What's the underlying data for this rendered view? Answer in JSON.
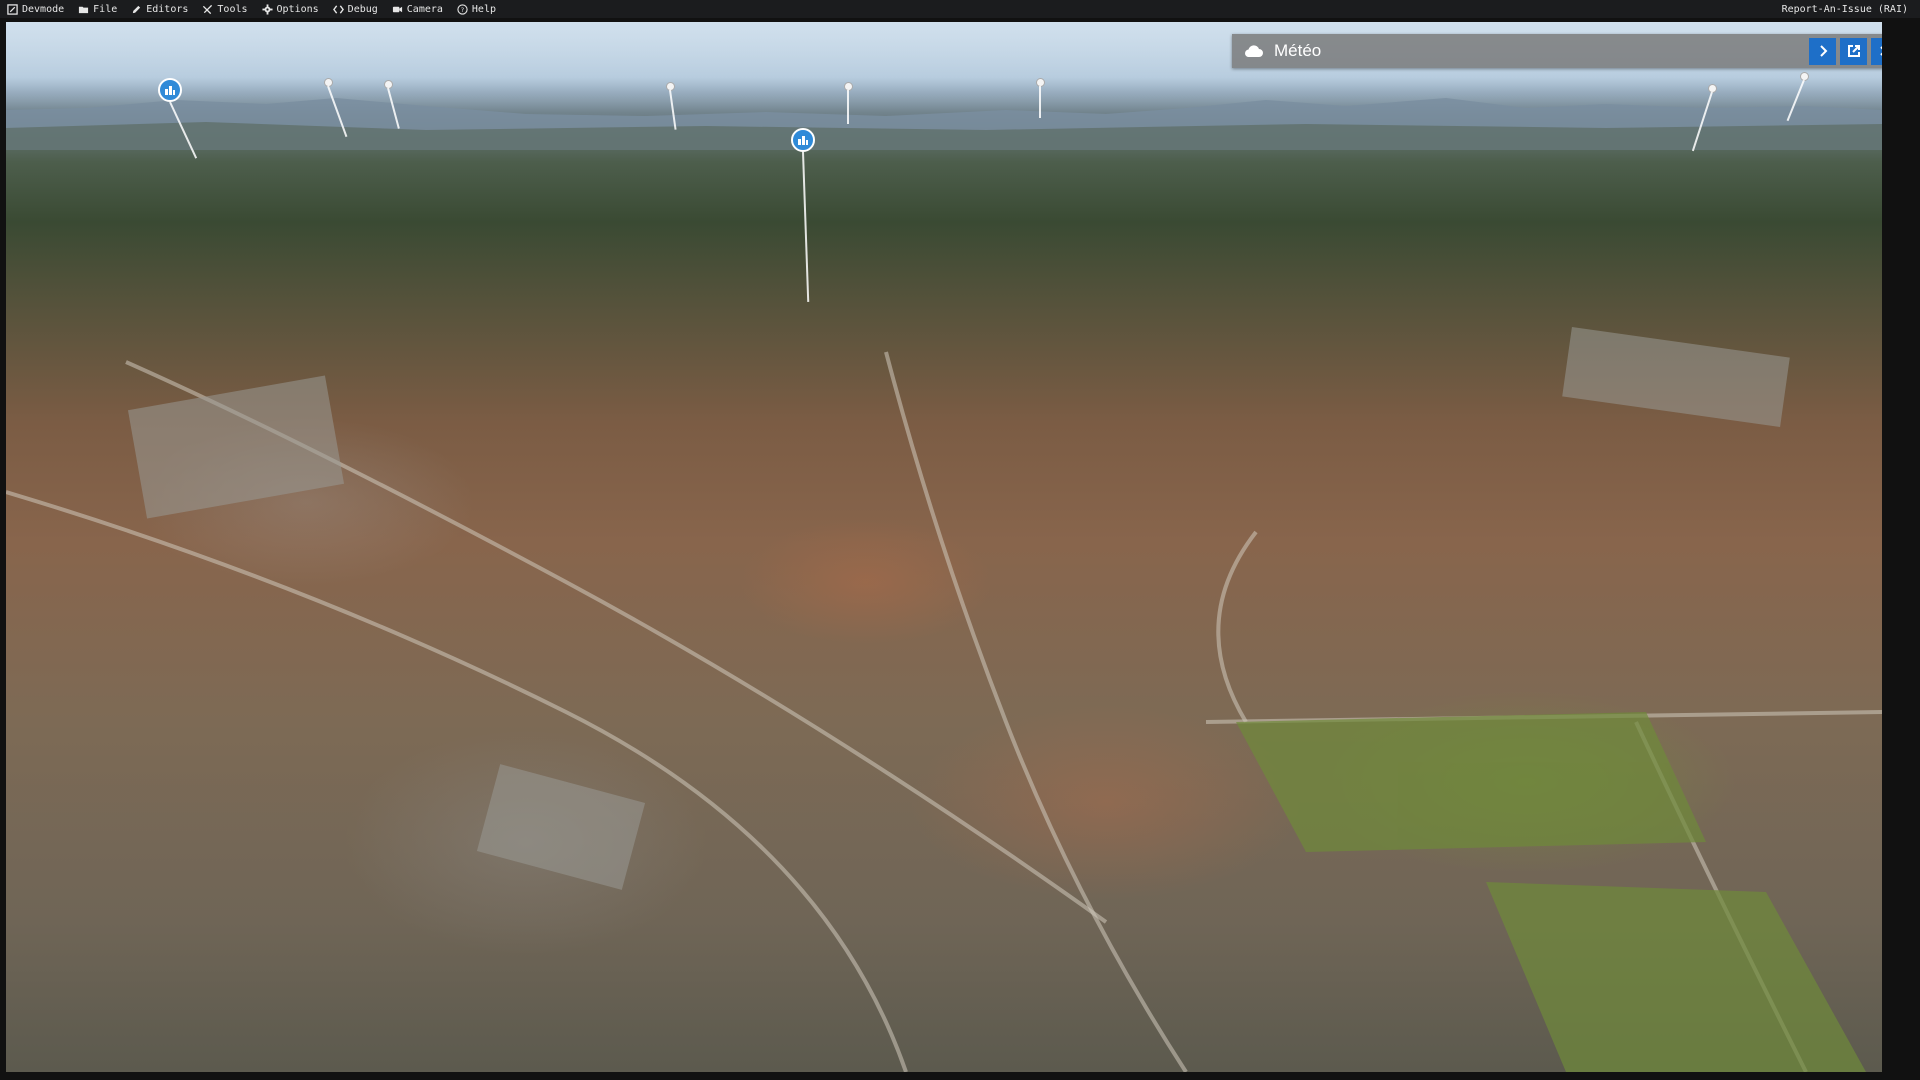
{
  "menubar": {
    "items": [
      {
        "label": "Devmode",
        "icon": "devmode-icon"
      },
      {
        "label": "File",
        "icon": "folder-icon"
      },
      {
        "label": "Editors",
        "icon": "pencil-icon"
      },
      {
        "label": "Tools",
        "icon": "tools-icon"
      },
      {
        "label": "Options",
        "icon": "gear-icon"
      },
      {
        "label": "Debug",
        "icon": "code-icon"
      },
      {
        "label": "Camera",
        "icon": "camera-icon"
      },
      {
        "label": "Help",
        "icon": "help-icon"
      }
    ],
    "report": "Report-An-Issue (RAI)"
  },
  "weather_panel": {
    "title": "Météo",
    "icon": "cloud-icon",
    "buttons": [
      "chevron-right-icon",
      "popout-icon",
      "close-icon"
    ],
    "accent": "#1e6fc8"
  },
  "scene": {
    "poi_badges": [
      "city-poi-icon",
      "city-poi-icon"
    ],
    "markers_small": 8
  }
}
